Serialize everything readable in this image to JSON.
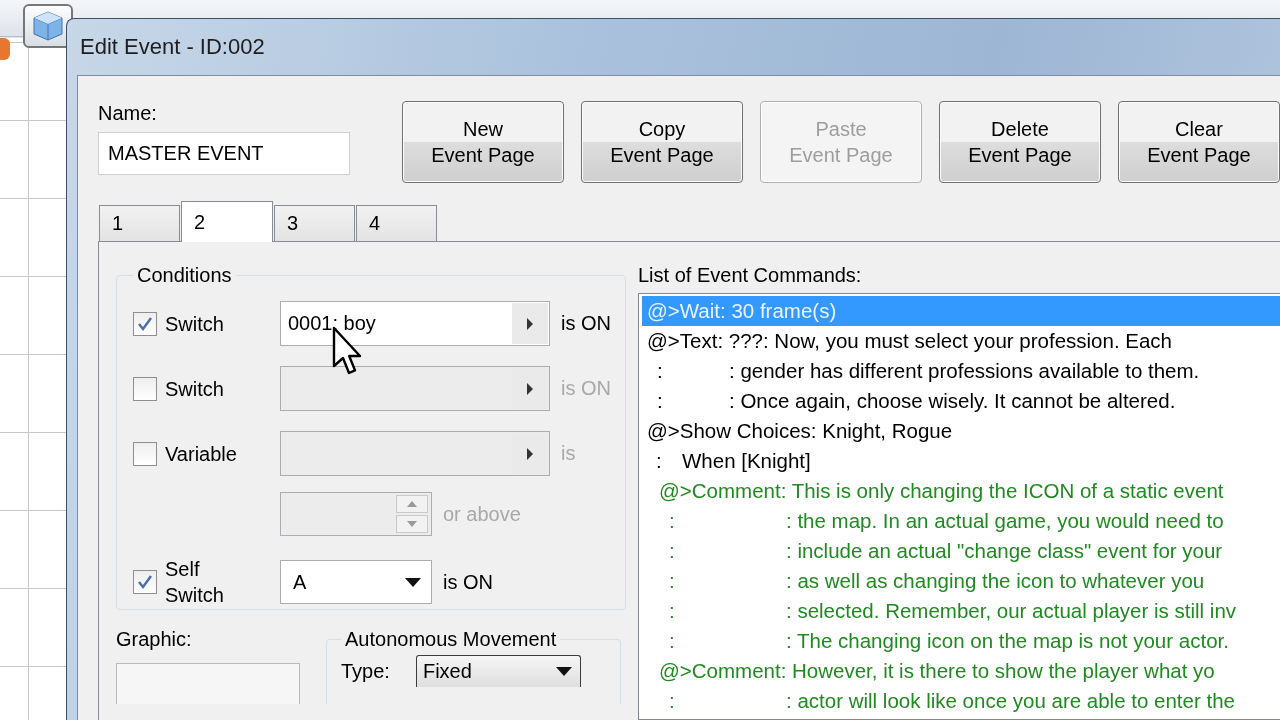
{
  "window": {
    "title": "Edit Event - ID:002"
  },
  "name": {
    "label": "Name:",
    "value": "MASTER EVENT"
  },
  "buttons": [
    {
      "lines": [
        "New",
        "Event Page"
      ],
      "disabled": false
    },
    {
      "lines": [
        "Copy",
        "Event Page"
      ],
      "disabled": false
    },
    {
      "lines": [
        "Paste",
        "Event Page"
      ],
      "disabled": true
    },
    {
      "lines": [
        "Delete",
        "Event Page"
      ],
      "disabled": false
    },
    {
      "lines": [
        "Clear",
        "Event Page"
      ],
      "disabled": false
    }
  ],
  "tabs": [
    {
      "label": "1",
      "selected": false
    },
    {
      "label": "2",
      "selected": true
    },
    {
      "label": "3",
      "selected": false
    },
    {
      "label": "4",
      "selected": false
    }
  ],
  "conditions": {
    "title": "Conditions",
    "rows": [
      {
        "kind": "switch",
        "label": "Switch",
        "checked": true,
        "value": "0001: boy",
        "suffix": "is ON"
      },
      {
        "kind": "switch",
        "label": "Switch",
        "checked": false,
        "suffix": "is ON"
      },
      {
        "kind": "variable",
        "label": "Variable",
        "checked": false,
        "suffix": "is",
        "compare": "or above"
      },
      {
        "kind": "self-switch",
        "label": "Self Switch",
        "checked": true,
        "value": "A",
        "suffix": "is ON"
      }
    ]
  },
  "graphic": {
    "label": "Graphic:"
  },
  "autonomous_movement": {
    "title": "Autonomous Movement",
    "type_label": "Type:",
    "type_value": "Fixed"
  },
  "commands": {
    "label": "List of Event Commands:",
    "items": [
      {
        "text": "@>Wait: 30 frame(s)",
        "selected": true
      },
      {
        "text": "@>Text: ???: Now, you must select your profession. Each",
        "selected": false,
        "lines": [
          {
            "lead": ":",
            "text": ": gender has different professions available to them."
          },
          {
            "lead": ":",
            "text": ": Once again, choose wisely. It cannot be altered."
          }
        ]
      },
      {
        "text": "@>Show Choices: Knight, Rogue",
        "selected": false,
        "children": [
          {
            "lead": ":",
            "text": "When [Knight]",
            "selected": false,
            "children": [
              {
                "kind": "comment",
                "text": "@>Comment: This is only changing the ICON of a static event",
                "selected": false,
                "lines": [
                  {
                    "lead": ":",
                    "text": ": the map. In an actual game, you would need to"
                  },
                  {
                    "lead": ":",
                    "text": ": include an actual \"change class\" event for your"
                  },
                  {
                    "lead": ":",
                    "text": ": as well as changing the icon to whatever you"
                  },
                  {
                    "lead": ":",
                    "text": ": selected. Remember, our actual player is still inv"
                  },
                  {
                    "lead": ":",
                    "text": ": The changing icon on the map is not your actor."
                  }
                ]
              },
              {
                "kind": "comment",
                "text": "@>Comment: However, it is there to show the player what yo",
                "selected": false,
                "lines": [
                  {
                    "lead": ":",
                    "text": ": actor will look like once you are able to enter the"
                  }
                ]
              }
            ]
          }
        ]
      }
    ]
  }
}
